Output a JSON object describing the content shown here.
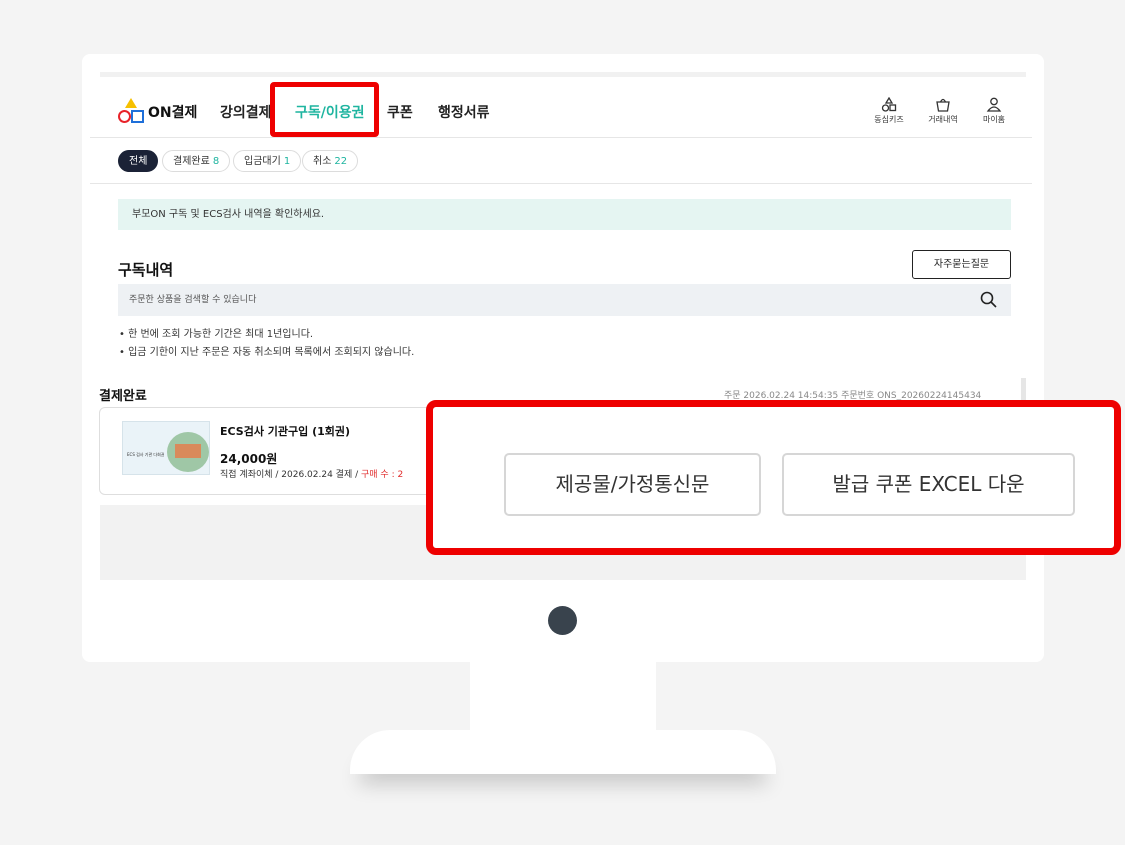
{
  "brand": "ON결제",
  "nav": {
    "items": [
      "강의결제",
      "구독/이용권",
      "쿠폰",
      "행정서류"
    ],
    "active": "구독/이용권"
  },
  "utility": [
    {
      "label": "동심키즈",
      "icon": "shapes-icon"
    },
    {
      "label": "거래내역",
      "icon": "bag-icon"
    },
    {
      "label": "마이홈",
      "icon": "user-icon"
    }
  ],
  "filters": [
    {
      "label": "전체",
      "count": ""
    },
    {
      "label": "결제완료",
      "count": "8"
    },
    {
      "label": "입금대기",
      "count": "1"
    },
    {
      "label": "취소",
      "count": "22"
    }
  ],
  "notice": "부모ON 구독 및 ECS검사 내역을 확인하세요.",
  "section_title": "구독내역",
  "faq_button": "자주묻는질문",
  "search_placeholder": "주문한 상품을 검색할 수 있습니다",
  "bullets": [
    "• 한 번에 조회 가능한 기간은 최대 1년입니다.",
    "• 입금 기한이 지난 주문은 자동 취소되며 목록에서 조회되지 않습니다."
  ],
  "order": {
    "status": "결제완료",
    "meta": "주문 2026.02.24 14:54:35   주문번호 ONS_20260224145434",
    "product_name": "ECS검사 기관구입 (1회권)",
    "price": "24,000원",
    "info": "직접 계좌이체  /  2026.02.24 결제  /",
    "qty": "구매 수 : 2",
    "thumb_text": "ECS 검사 기관 다회권"
  },
  "zoom": {
    "button1": "제공물/가정통신문",
    "button2": "발급 쿠폰 EXCEL 다운"
  },
  "colors": {
    "accent": "#1fb5a0",
    "highlight": "#ee0000",
    "notice_bg": "#e5f5f2",
    "dark_pill": "#1b2236"
  }
}
